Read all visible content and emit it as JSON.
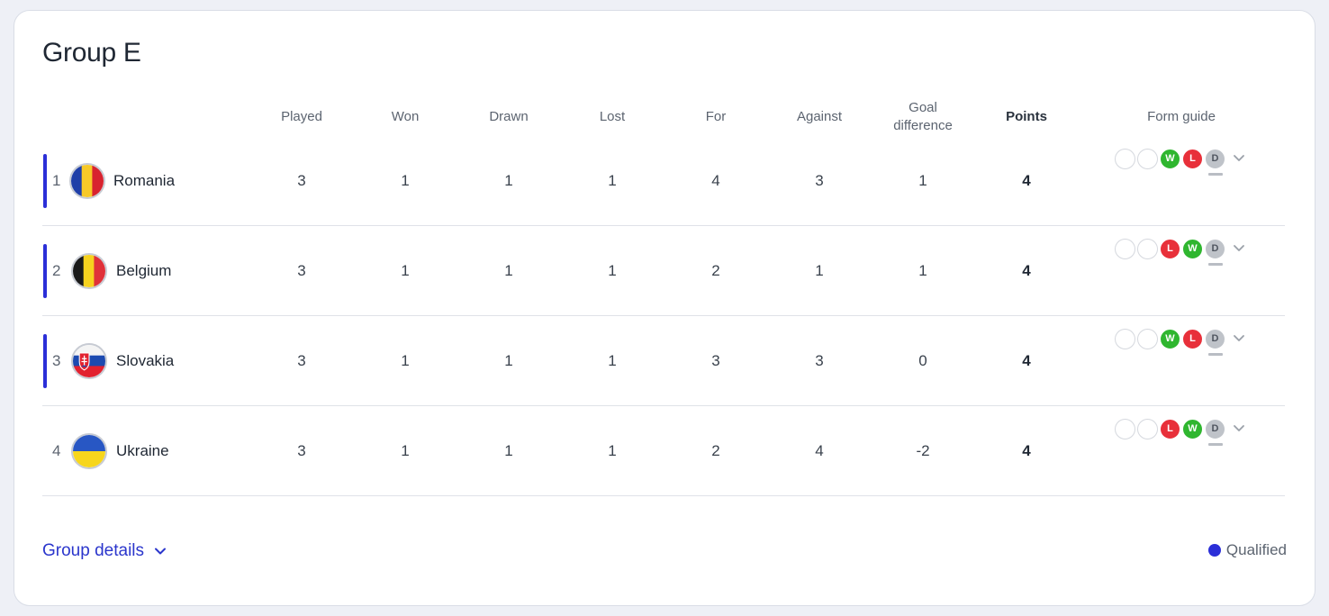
{
  "group": {
    "title": "Group E"
  },
  "columns": {
    "played": "Played",
    "won": "Won",
    "drawn": "Drawn",
    "lost": "Lost",
    "for": "For",
    "against": "Against",
    "goal_diff_line1": "Goal",
    "goal_diff_line2": "difference",
    "points": "Points",
    "form": "Form guide"
  },
  "rows": [
    {
      "pos": "1",
      "team": "Romania",
      "flag": "romania-flag-icon",
      "qualified": true,
      "played": "3",
      "won": "1",
      "drawn": "1",
      "lost": "1",
      "for": "4",
      "against": "3",
      "gd": "1",
      "points": "4",
      "form": [
        "",
        "",
        "W",
        "L",
        "D"
      ]
    },
    {
      "pos": "2",
      "team": "Belgium",
      "flag": "belgium-flag-icon",
      "qualified": true,
      "played": "3",
      "won": "1",
      "drawn": "1",
      "lost": "1",
      "for": "2",
      "against": "1",
      "gd": "1",
      "points": "4",
      "form": [
        "",
        "",
        "L",
        "W",
        "D"
      ]
    },
    {
      "pos": "3",
      "team": "Slovakia",
      "flag": "slovakia-flag-icon",
      "qualified": true,
      "played": "3",
      "won": "1",
      "drawn": "1",
      "lost": "1",
      "for": "3",
      "against": "3",
      "gd": "0",
      "points": "4",
      "form": [
        "",
        "",
        "W",
        "L",
        "D"
      ]
    },
    {
      "pos": "4",
      "team": "Ukraine",
      "flag": "ukraine-flag-icon",
      "qualified": false,
      "played": "3",
      "won": "1",
      "drawn": "1",
      "lost": "1",
      "for": "2",
      "against": "4",
      "gd": "-2",
      "points": "4",
      "form": [
        "",
        "",
        "L",
        "W",
        "D"
      ]
    }
  ],
  "footer": {
    "details_label": "Group details",
    "legend_label": "Qualified"
  },
  "colors": {
    "qualified": "#2b2fd8",
    "win": "#2fb62f",
    "loss": "#e8303a",
    "draw": "#bfc3c9",
    "link": "#2b36cc"
  }
}
